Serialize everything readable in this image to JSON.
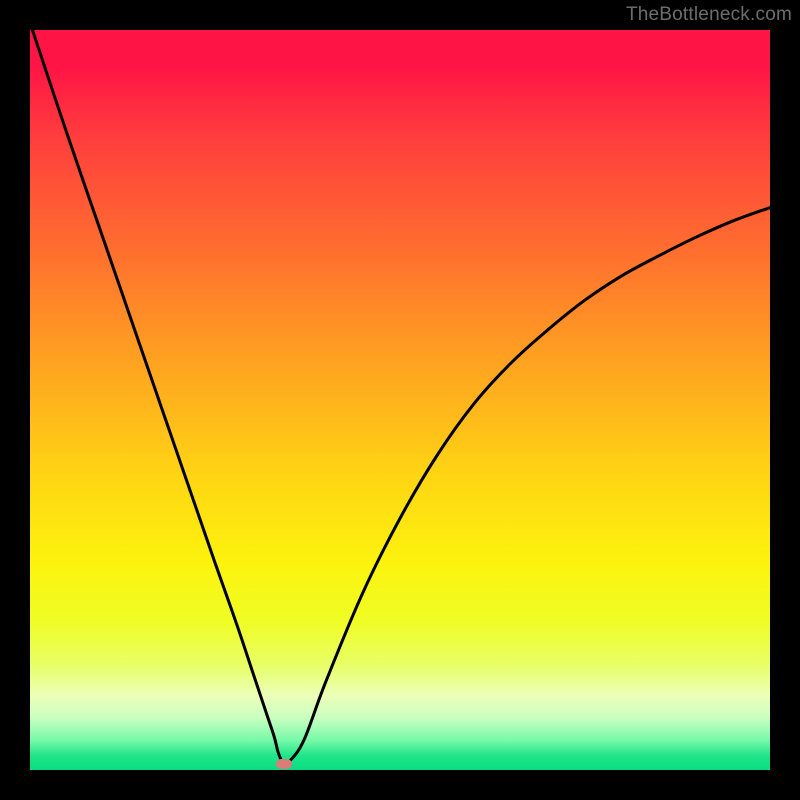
{
  "watermark": "TheBottleneck.com",
  "colors": {
    "frame": "#000000",
    "curve": "#000000",
    "marker": "#d97d79",
    "watermark_text": "#6d6d6d"
  },
  "chart_data": {
    "type": "line",
    "title": "",
    "xlabel": "",
    "ylabel": "",
    "xlim": [
      0,
      100
    ],
    "ylim": [
      0,
      100
    ],
    "series": [
      {
        "name": "bottleneck-curve",
        "x": [
          0,
          5,
          10,
          15,
          20,
          25,
          28,
          30,
          31,
          32,
          33,
          33.5,
          34,
          34.2,
          34.5,
          35,
          37,
          40,
          45,
          50,
          55,
          60,
          65,
          70,
          75,
          80,
          85,
          90,
          95,
          100
        ],
        "y": [
          101,
          86,
          71.5,
          57,
          42.5,
          28,
          19.5,
          13.5,
          10.5,
          7.5,
          4.5,
          2.5,
          1.2,
          0.8,
          0.8,
          1.1,
          4,
          12,
          24,
          34,
          42.5,
          49.5,
          55,
          59.5,
          63.5,
          66.8,
          69.5,
          72,
          74.2,
          76
        ]
      }
    ],
    "annotations": [
      {
        "name": "marker",
        "x": 34.3,
        "y": 0.8
      }
    ]
  }
}
